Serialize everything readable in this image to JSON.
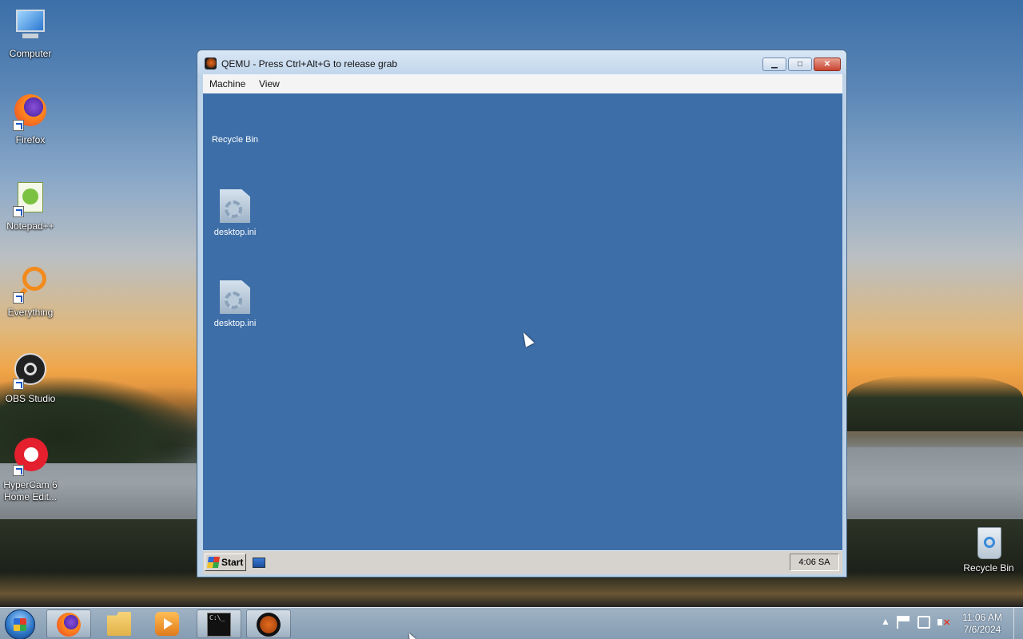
{
  "desktop": {
    "icons": [
      {
        "label": "Computer"
      },
      {
        "label": "Firefox"
      },
      {
        "label": "Notepad++"
      },
      {
        "label": "Everything"
      },
      {
        "label": "OBS Studio"
      },
      {
        "label": "HyperCam 6 Home Edit..."
      }
    ],
    "recycle_bin": {
      "label": "Recycle Bin"
    }
  },
  "qemu_window": {
    "title": "QEMU - Press Ctrl+Alt+G to release grab",
    "menu": [
      "Machine",
      "View"
    ],
    "guest": {
      "icons": [
        {
          "label": "Recycle Bin"
        },
        {
          "label": "desktop.ini"
        },
        {
          "label": "desktop.ini"
        }
      ],
      "taskbar": {
        "start_label": "Start",
        "clock": "4:06 SA"
      }
    }
  },
  "taskbar": {
    "pinned": [
      "Firefox",
      "File Explorer",
      "Windows Media Player",
      "Command Prompt",
      "QEMU"
    ],
    "clock": {
      "time": "11:06 AM",
      "date": "7/6/2024"
    }
  },
  "colors": {
    "guest_desktop": "#3d6ea8",
    "guest_taskbar": "#d6d3ce",
    "close_button": "#c84530"
  }
}
